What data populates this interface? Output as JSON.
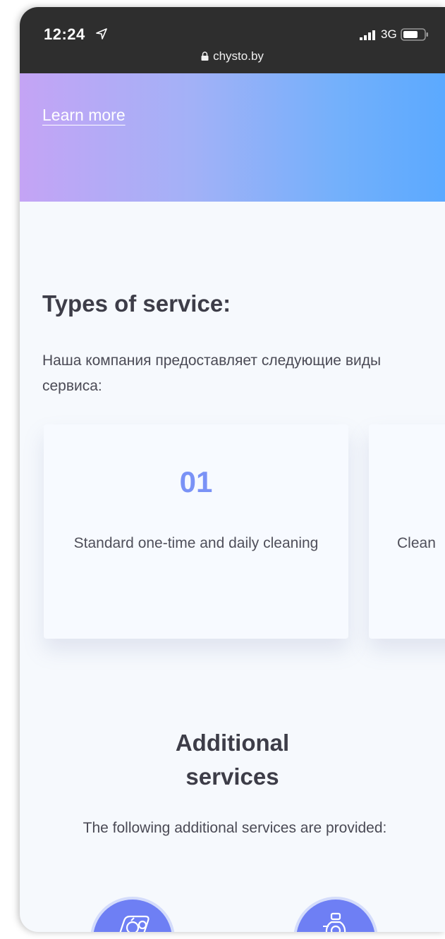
{
  "status_bar": {
    "time": "12:24",
    "network": "3G",
    "url": "chysto.by",
    "icons": [
      "location-arrow-icon",
      "signal-bars-icon",
      "battery-icon",
      "lock-icon"
    ]
  },
  "hero": {
    "learn_more": "Learn more",
    "gradient_colors": [
      "#c4a4f5",
      "#5ba9ff"
    ]
  },
  "types_section": {
    "title": "Types of service:",
    "description": "Наша компания предоставляет следующие виды сервиса:",
    "cards": [
      {
        "number": "01",
        "text": "Standard one-time and daily cleaning"
      },
      {
        "number": "",
        "text": "Clean"
      }
    ]
  },
  "additional_section": {
    "title_line1": "Additional",
    "title_line2": "services",
    "description": "The following additional services are provided:",
    "icons": [
      "washing-machine-icon",
      "vacuum-cleaner-icon"
    ]
  },
  "colors": {
    "accent": "#7a92f6",
    "circle": "#6e7ff4",
    "heading": "#3d3d48"
  }
}
